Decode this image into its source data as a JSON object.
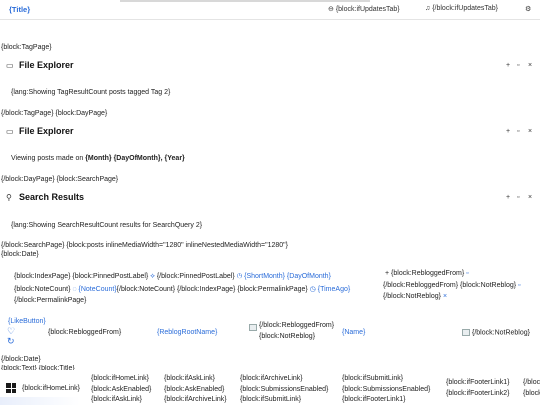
{
  "topbar": {
    "title": "{Title}",
    "updates_tab_1": "{block:ifUpdatesTab}",
    "updates_tab_2": "{/block:ifUpdatesTab}",
    "updates_icon": "history-icon",
    "bell_icon": "bell-icon",
    "settings_icon": "gear-icon"
  },
  "tag_section": {
    "open": "{block:TagPage}",
    "panel_title": "File Explorer",
    "panel_icon": "folder-icon",
    "body": "{lang:Showing TagResultCount posts tagged Tag 2}",
    "close_open": "{/block:TagPage} {block:DayPage}"
  },
  "day_section": {
    "panel_title": "File Explorer",
    "panel_icon": "folder-icon",
    "body_prefix": "Viewing posts made on ",
    "body_bold": "{Month} {DayOfMonth}, {Year}",
    "close_open": "{/block:DayPage} {block:SearchPage}"
  },
  "search_section": {
    "panel_title": "Search Results",
    "panel_icon": "search-icon",
    "body": "{lang:Showing SearchResultCount results for SearchQuery 2}",
    "close": "{/block:SearchPage} {block:posts inlineMediaWidth=\"1280\" inlineNestedMediaWidth=\"1280\"}",
    "date_open": "{block:Date}"
  },
  "panel_controls": {
    "add": "+",
    "restore": "▫",
    "close": "×"
  },
  "post": {
    "line1_a": "{block:IndexPage} {block:PinnedPostLabel}",
    "line1_b": "{/block:PinnedPostLabel}",
    "line1_c": "{ShortMonth} {DayOfMonth}",
    "line2_a": "{block:NoteCount}",
    "line2_b": "{NoteCount}",
    "line2_c": "{/block:NoteCount} {/block:IndexPage} {block:PermalinkPage}",
    "line2_d": "{TimeAgo}",
    "line3": "{/block:PermalinkPage}",
    "right1": "+ {block:RebloggedFrom}",
    "right2": "{/block:RebloggedFrom} {block:NotReblog}",
    "right3": "{/block:NotReblog}",
    "right3_x": "×"
  },
  "reblog": {
    "like_button": "{LikeButton}",
    "reblogged_from": "{block:RebloggedFrom}",
    "reblog_root_name": "{ReblogRootName}",
    "img_line1": "{/block:RebloggedFrom}",
    "img_line2": "{block:NotReblog}",
    "name": "{Name}",
    "not_reblog_end": "{/block:NotReblog}"
  },
  "date_close": "{/block:Date}",
  "text_open": "{block:Text} {block:Title}",
  "footer": {
    "home": "{block:ifHomeLink}",
    "col1": [
      "{block:ifHomeLink}",
      "{block:AskEnabled}",
      "{block:ifAskLink}"
    ],
    "col2": [
      "{block:ifAskLink}",
      "{block:AskEnabled}",
      "{block:ifArchiveLink}"
    ],
    "col3": [
      "{block:ifArchiveLink}",
      "{block:SubmissionsEnabled}",
      "{block:ifSubmitLink}"
    ],
    "col4": [
      "{block:ifSubmitLink}",
      "{block:SubmissionsEnabled}",
      "{block:ifFooterLink1}"
    ],
    "col5": [
      "{block:ifFooterLink1}",
      "{block:ifFooterLink2}"
    ],
    "col6": [
      "{/bloc",
      "{block:"
    ],
    "start_icon": "windows-icon"
  }
}
